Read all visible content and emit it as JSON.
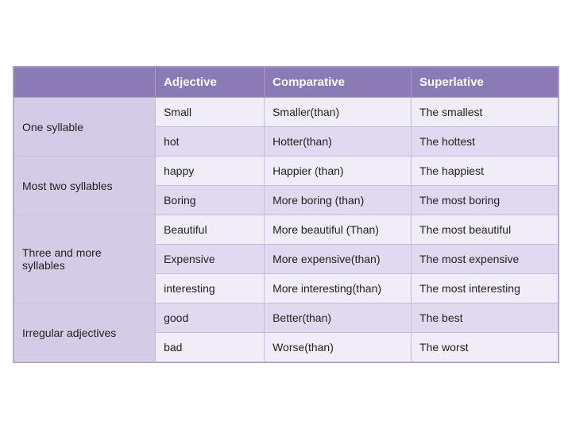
{
  "table": {
    "headers": [
      "",
      "Adjective",
      "Comparative",
      "Superlative"
    ],
    "rows": [
      {
        "category": "One syllable",
        "category_rowspan": 2,
        "adjective": "Small",
        "comparative": "Smaller(than)",
        "superlative": "The smallest",
        "shade": "light",
        "is_first": true
      },
      {
        "category": "",
        "adjective": "hot",
        "comparative": "Hotter(than)",
        "superlative": "The hottest",
        "shade": "dark",
        "is_first": false
      },
      {
        "category": "Most  two syllables",
        "category_rowspan": 2,
        "adjective": "happy",
        "comparative": "Happier (than)",
        "superlative": "The happiest",
        "shade": "light",
        "is_first": true
      },
      {
        "category": "",
        "adjective": "Boring",
        "comparative": "More boring (than)",
        "superlative": "The most boring",
        "shade": "dark",
        "is_first": false
      },
      {
        "category": "Three and more syllables",
        "category_rowspan": 3,
        "adjective": "Beautiful",
        "comparative": "More beautiful (Than)",
        "superlative": "The most beautiful",
        "shade": "light",
        "is_first": true
      },
      {
        "category": "",
        "adjective": "Expensive",
        "comparative": "More expensive(than)",
        "superlative": "The most expensive",
        "shade": "dark",
        "is_first": false
      },
      {
        "category": "",
        "adjective": "interesting",
        "comparative": "More interesting(than)",
        "superlative": "The most interesting",
        "shade": "light",
        "is_first": false
      },
      {
        "category": "Irregular adjectives",
        "category_rowspan": 2,
        "adjective": "good",
        "comparative": "Better(than)",
        "superlative": "The best",
        "shade": "dark",
        "is_first": true
      },
      {
        "category": "",
        "adjective": "bad",
        "comparative": "Worse(than)",
        "superlative": "The worst",
        "shade": "light",
        "is_first": false
      }
    ]
  }
}
